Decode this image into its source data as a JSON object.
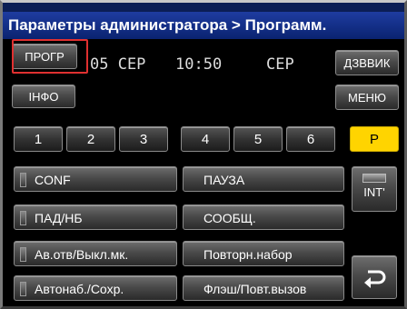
{
  "title": "Параметры администратора > Программ.",
  "top": {
    "prog_label": "ПРОГР",
    "info_label": "ІНФО",
    "date": "05 СЕР",
    "time": "10:50",
    "day": "СЕР",
    "ring_label": "ДЗВВИК",
    "menu_label": "МЕНЮ"
  },
  "number_keys": [
    "1",
    "2",
    "3",
    "4",
    "5",
    "6"
  ],
  "p_key": "P",
  "left_keys": [
    "CONF",
    "ПАД/НБ",
    "Ав.отв/Выкл.мк.",
    "Автонаб./Сохр."
  ],
  "right_keys": [
    "ПАУЗА",
    "СООБЩ.",
    "Повторн.набор",
    "Флэш/Повт.вызов"
  ],
  "int_label": "INT'",
  "back_icon": "return-arrow-icon",
  "colors": {
    "title_bg": "#0a2370",
    "p_key": "#ffd400",
    "highlight": "#e03030"
  }
}
